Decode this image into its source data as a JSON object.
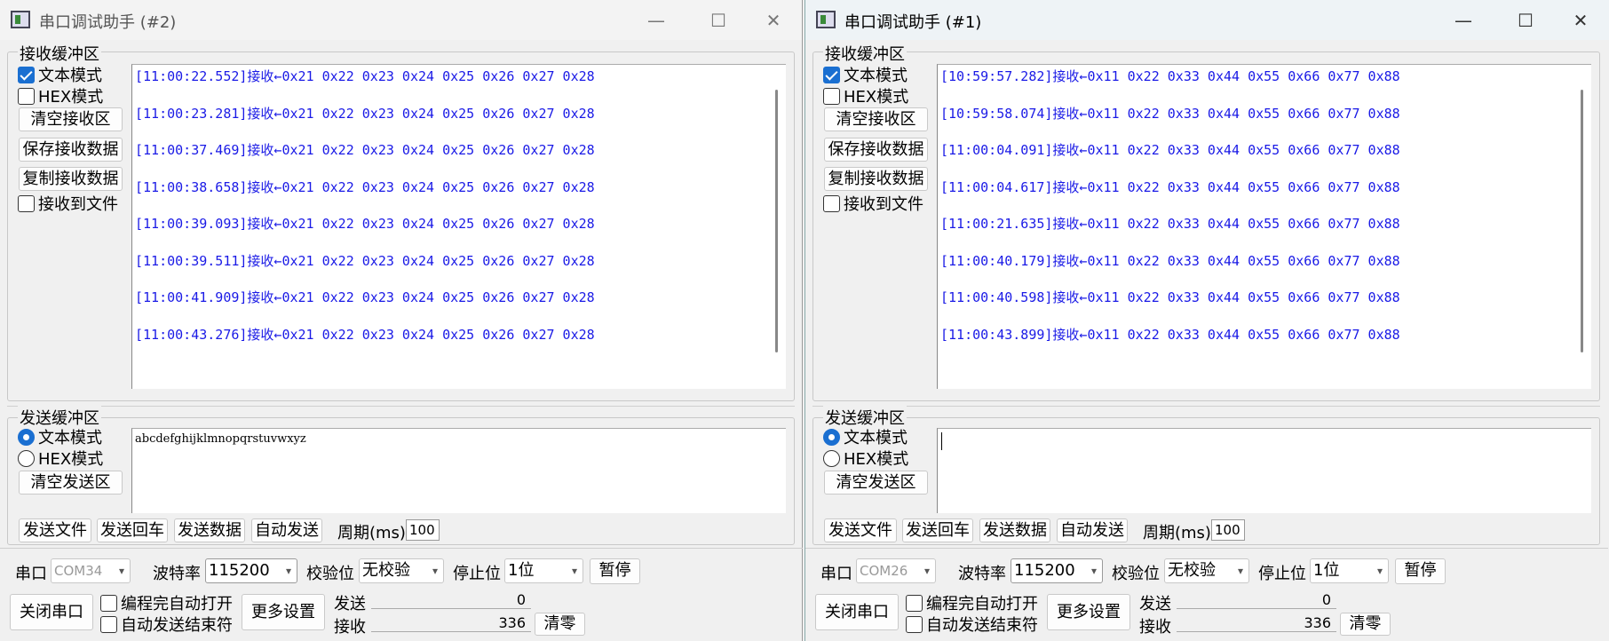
{
  "windows": [
    {
      "id": "w2",
      "title": "串口调试助手 (#2)",
      "recv_label": "接收缓冲区",
      "recv_text_mode": "文本模式",
      "recv_hex_mode": "HEX模式",
      "clear_recv": "清空接收区",
      "save_recv": "保存接收数据",
      "copy_recv": "复制接收数据",
      "recv_to_file": "接收到文件",
      "recv_lines": [
        "[11:00:22.552]接收←0x21 0x22 0x23 0x24 0x25 0x26 0x27 0x28",
        "[11:00:23.281]接收←0x21 0x22 0x23 0x24 0x25 0x26 0x27 0x28",
        "[11:00:37.469]接收←0x21 0x22 0x23 0x24 0x25 0x26 0x27 0x28",
        "[11:00:38.658]接收←0x21 0x22 0x23 0x24 0x25 0x26 0x27 0x28",
        "[11:00:39.093]接收←0x21 0x22 0x23 0x24 0x25 0x26 0x27 0x28",
        "[11:00:39.511]接收←0x21 0x22 0x23 0x24 0x25 0x26 0x27 0x28",
        "[11:00:41.909]接收←0x21 0x22 0x23 0x24 0x25 0x26 0x27 0x28",
        "[11:00:43.276]接收←0x21 0x22 0x23 0x24 0x25 0x26 0x27 0x28"
      ],
      "send_label": "发送缓冲区",
      "send_text_mode": "文本模式",
      "send_hex_mode": "HEX模式",
      "clear_send": "清空发送区",
      "send_text": "abcdefghijklmnopqrstuvwxyz",
      "send_file": "发送文件",
      "send_cr": "发送回车",
      "send_data": "发送数据",
      "auto_send": "自动发送",
      "period_label": "周期(ms)",
      "period_value": "100",
      "port_label": "串口",
      "port_value": "COM34",
      "baud_label": "波特率",
      "baud_value": "115200",
      "parity_label": "校验位",
      "parity_value": "无校验",
      "stop_label": "停止位",
      "stop_value": "1位",
      "pause": "暂停",
      "close_port": "关闭串口",
      "auto_open": "编程完自动打开",
      "auto_terminator": "自动发送结束符",
      "more_settings": "更多设置",
      "sent_label": "发送",
      "sent_count": "0",
      "recv_count_label": "接收",
      "recv_count": "336",
      "clear_count": "清零"
    },
    {
      "id": "w1",
      "title": "串口调试助手 (#1)",
      "recv_label": "接收缓冲区",
      "recv_text_mode": "文本模式",
      "recv_hex_mode": "HEX模式",
      "clear_recv": "清空接收区",
      "save_recv": "保存接收数据",
      "copy_recv": "复制接收数据",
      "recv_to_file": "接收到文件",
      "recv_lines": [
        "[10:59:57.282]接收←0x11 0x22 0x33 0x44 0x55 0x66 0x77 0x88",
        "[10:59:58.074]接收←0x11 0x22 0x33 0x44 0x55 0x66 0x77 0x88",
        "[11:00:04.091]接收←0x11 0x22 0x33 0x44 0x55 0x66 0x77 0x88",
        "[11:00:04.617]接收←0x11 0x22 0x33 0x44 0x55 0x66 0x77 0x88",
        "[11:00:21.635]接收←0x11 0x22 0x33 0x44 0x55 0x66 0x77 0x88",
        "[11:00:40.179]接收←0x11 0x22 0x33 0x44 0x55 0x66 0x77 0x88",
        "[11:00:40.598]接收←0x11 0x22 0x33 0x44 0x55 0x66 0x77 0x88",
        "[11:00:43.899]接收←0x11 0x22 0x33 0x44 0x55 0x66 0x77 0x88"
      ],
      "send_label": "发送缓冲区",
      "send_text_mode": "文本模式",
      "send_hex_mode": "HEX模式",
      "clear_send": "清空发送区",
      "send_text": "",
      "send_file": "发送文件",
      "send_cr": "发送回车",
      "send_data": "发送数据",
      "auto_send": "自动发送",
      "period_label": "周期(ms)",
      "period_value": "100",
      "port_label": "串口",
      "port_value": "COM26",
      "baud_label": "波特率",
      "baud_value": "115200",
      "parity_label": "校验位",
      "parity_value": "无校验",
      "stop_label": "停止位",
      "stop_value": "1位",
      "pause": "暂停",
      "close_port": "关闭串口",
      "auto_open": "编程完自动打开",
      "auto_terminator": "自动发送结束符",
      "more_settings": "更多设置",
      "sent_label": "发送",
      "sent_count": "0",
      "recv_count_label": "接收",
      "recv_count": "336",
      "clear_count": "清零"
    }
  ],
  "icons": {
    "minimize": "—",
    "maximize": "☐",
    "close": "✕",
    "dropdown": "▾"
  },
  "colors": {
    "recv_text": "#1a1ae6",
    "accent": "#1a6fd1"
  }
}
